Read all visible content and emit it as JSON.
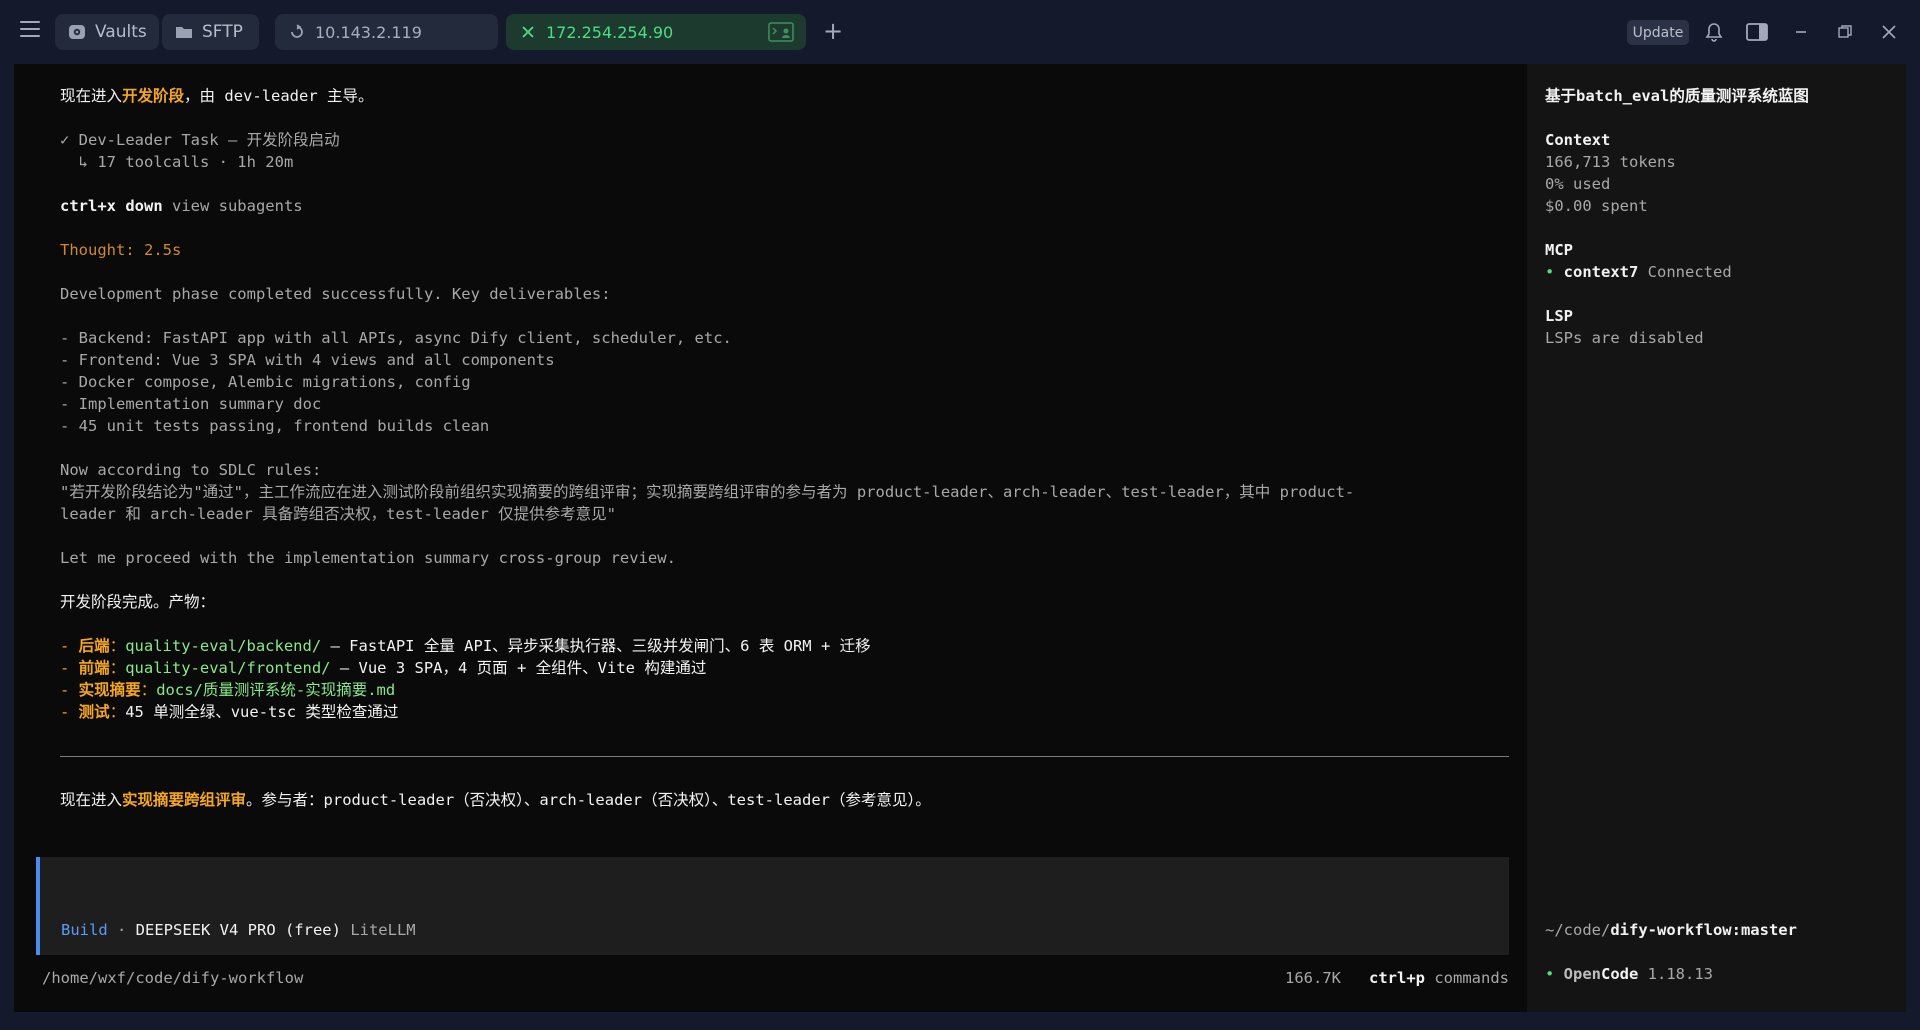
{
  "topbar": {
    "tabs": [
      {
        "label": "Vaults",
        "icon": "vault-icon"
      },
      {
        "label": "SFTP",
        "icon": "folder-icon"
      },
      {
        "label": "10.143.2.119",
        "icon": "ssh-icon"
      },
      {
        "label": "172.254.254.90",
        "icon": "close-icon",
        "active": true
      }
    ],
    "update_label": "Update"
  },
  "terminal": {
    "l1_a": "现在进入",
    "l1_b": "开发阶段",
    "l1_c": "，由 dev-leader 主导。",
    "task_title": "✓ Dev-Leader Task — 开发阶段启动",
    "task_meta": "  ↳ 17 toolcalls · 1h 20m",
    "kb_key": "ctrl+x down",
    "kb_desc": " view subagents",
    "thought": "Thought: 2.5s",
    "dev_done": "Development phase completed successfully. Key deliverables:",
    "bullets": [
      "- Backend: FastAPI app with all APIs, async Dify client, scheduler, etc.",
      "- Frontend: Vue 3 SPA with 4 views and all components",
      "- Docker compose, Alembic migrations, config",
      "- Implementation summary doc",
      "- 45 unit tests passing, frontend builds clean"
    ],
    "sdlc": "Now according to SDLC rules:",
    "quote1": "\"若开发阶段结论为\"通过\"，主工作流应在进入测试阶段前组织实现摘要的跨组评审；实现摘要跨组评审的参与者为 product-leader、arch-leader、test-leader，其中 product-",
    "quote2": "leader 和 arch-leader 具备跨组否决权，test-leader 仅提供参考意见\"",
    "proceed": "Let me proceed with the implementation summary cross-group review.",
    "done_cn": "开发阶段完成。产物：",
    "products": [
      {
        "label": "后端",
        "path": "quality-eval/backend/",
        "desc": " — FastAPI 全量 API、异步采集执行器、三级并发闸门、6 表 ORM + 迁移"
      },
      {
        "label": "前端",
        "path": "quality-eval/frontend/",
        "desc": " — Vue 3 SPA，4 页面 + 全组件、Vite 构建通过"
      },
      {
        "label": "实现摘要",
        "path": "docs/质量测评系统-实现摘要.md",
        "desc": ""
      },
      {
        "label": "测试",
        "path": "",
        "desc": "45 单测全绿、vue-tsc 类型检查通过"
      }
    ],
    "review_a": "现在进入",
    "review_b": "实现摘要跨组评审",
    "review_c": "。参与者：product-leader（否决权）、arch-leader（否决权）、test-leader（参考意见）。",
    "build_mode": "Build",
    "build_sep": " · ",
    "build_model": "DEEPSEEK V4 PRO (free)",
    "build_provider": " LiteLLM",
    "cwd": "/home/wxf/code/dify-workflow",
    "tokens_short": "166.7K",
    "cmd_key": "ctrl+p",
    "cmd_desc": " commands"
  },
  "side": {
    "title": "基于batch_eval的质量测评系统蓝图",
    "context_h": "Context",
    "tokens": "166,713 tokens",
    "used": "0% used",
    "spent": "$0.00 spent",
    "mcp_h": "MCP",
    "mcp_name": "context7",
    "mcp_status": " Connected",
    "lsp_h": "LSP",
    "lsp_status": "LSPs are disabled",
    "path_prefix": "~/code/",
    "path_repo": "dify-workflow:master",
    "app_open": "Open",
    "app_code": "Code",
    "version": " 1.18.13"
  }
}
